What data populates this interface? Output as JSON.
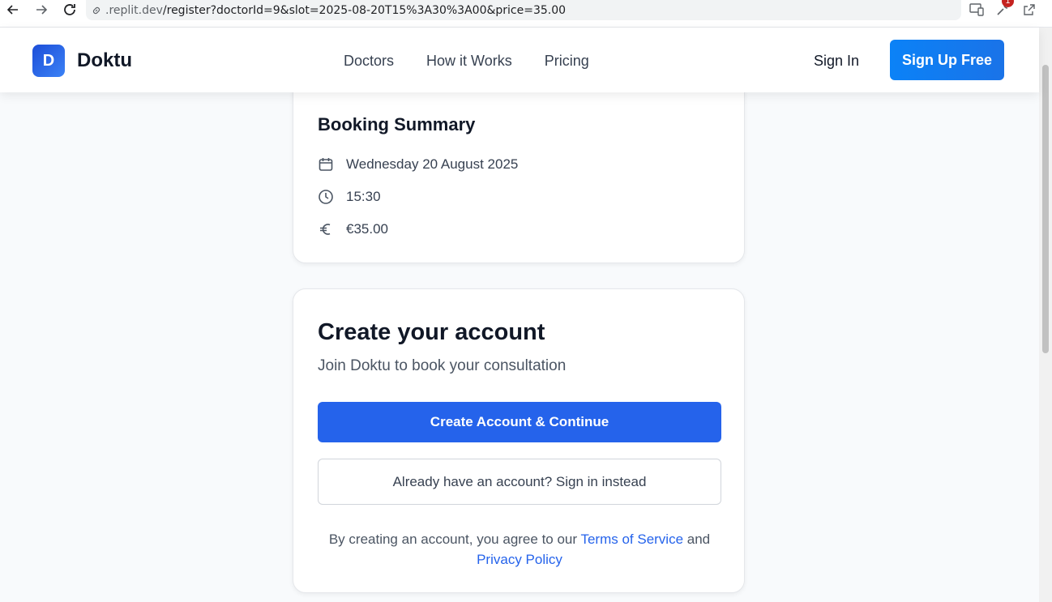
{
  "browser": {
    "url_host": ".replit.dev",
    "url_path": "/register?doctorId=9&slot=2025-08-20T15%3A30%3A00&price=35.00",
    "extension_badge": "1",
    "icons": [
      "back-icon",
      "forward-icon",
      "reload-icon",
      "link-icon",
      "devices-icon",
      "wrench-icon",
      "open-external-icon"
    ]
  },
  "header": {
    "logo_letter": "D",
    "brand": "Doktu",
    "nav": [
      {
        "label": "Doctors"
      },
      {
        "label": "How it Works"
      },
      {
        "label": "Pricing"
      }
    ],
    "sign_in": "Sign In",
    "sign_up": "Sign Up Free"
  },
  "summary": {
    "title": "Booking Summary",
    "date": "Wednesday 20 August 2025",
    "time": "15:30",
    "price": "€35.00",
    "icons": {
      "date": "calendar-icon",
      "time": "clock-icon",
      "price": "euro-icon"
    }
  },
  "account": {
    "title": "Create your account",
    "subtitle": "Join Doktu to book your consultation",
    "primary_button": "Create Account & Continue",
    "secondary_button": "Already have an account? Sign in instead",
    "legal_prefix": "By creating an account, you agree to our ",
    "terms_link": "Terms of Service",
    "legal_and": " and",
    "privacy_link": "Privacy Policy"
  },
  "colors": {
    "primary": "#2563eb",
    "signup_gradient_start": "#0b82f7",
    "page_bg": "#f8fafc"
  }
}
